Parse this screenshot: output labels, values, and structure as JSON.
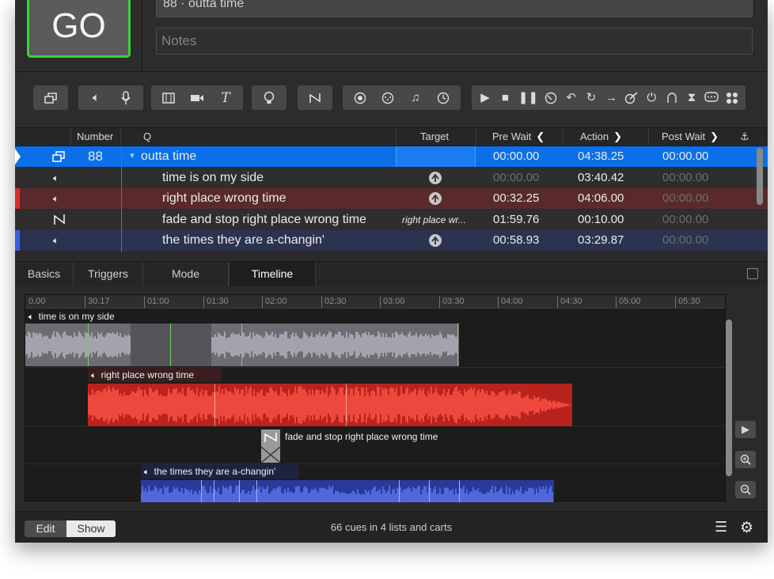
{
  "go_button": {
    "label": "GO"
  },
  "cue_name_field": {
    "value": "88 · outta time"
  },
  "notes_field": {
    "placeholder": "Notes"
  },
  "columns": {
    "number": "Number",
    "q": "Q",
    "target": "Target",
    "pre_wait": "Pre Wait",
    "action": "Action",
    "post_wait": "Post Wait"
  },
  "cues": [
    {
      "number": "88",
      "name": "outta time",
      "target": "",
      "pre_wait": "00:00.00",
      "action": "04:38.25",
      "post_wait": "00:00.00",
      "type": "group",
      "color": "#0a6fe8"
    },
    {
      "number": "",
      "name": "time is on my side",
      "target": "up-arrow-icon",
      "pre_wait": "00:00.00",
      "action": "03:40.42",
      "post_wait": "00:00.00",
      "type": "audio",
      "color": ""
    },
    {
      "number": "",
      "name": "right place wrong time",
      "target": "up-arrow-icon",
      "pre_wait": "00:32.25",
      "action": "04:06.00",
      "post_wait": "00:00.00",
      "type": "audio",
      "color": "#e02b2b"
    },
    {
      "number": "",
      "name": "fade and stop right place wrong time",
      "target": "right place wr...",
      "pre_wait": "01:59.76",
      "action": "00:10.00",
      "post_wait": "00:00.00",
      "type": "fade",
      "color": ""
    },
    {
      "number": "",
      "name": "the times they are a-changin'",
      "target": "up-arrow-icon",
      "pre_wait": "00:58.93",
      "action": "03:29.87",
      "post_wait": "00:00.00",
      "type": "audio",
      "color": "#3b5ee0"
    }
  ],
  "tabs": [
    "Basics",
    "Triggers",
    "Mode",
    "Timeline"
  ],
  "active_tab": "Timeline",
  "timeline": {
    "ruler": [
      "0.00",
      "30.17",
      "01:00",
      "01:30",
      "02:00",
      "02:30",
      "03:00",
      "03:30",
      "04:00",
      "04:30",
      "05:00",
      "05:30"
    ],
    "tracks": [
      {
        "label": "time is on my side",
        "color": "#9a98a6"
      },
      {
        "label": "right place wrong time",
        "color": "#ff4a3f"
      },
      {
        "label": "fade and stop right place wrong time",
        "color": "#888888"
      },
      {
        "label": "the times they are a-changin'",
        "color": "#4a63e6"
      }
    ]
  },
  "footer": {
    "edit_label": "Edit",
    "show_label": "Show",
    "status": "66 cues in 4 lists and carts"
  },
  "colors": {
    "accent": "#0a6fe8",
    "go_border": "#39d13a",
    "group_line": "#3e8f3e"
  }
}
